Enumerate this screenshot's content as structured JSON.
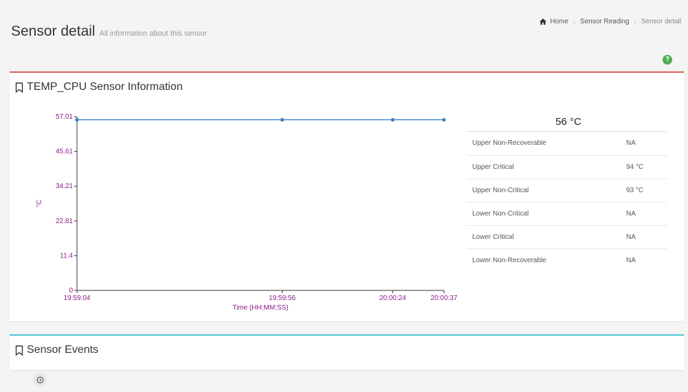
{
  "header": {
    "title": "Sensor detail",
    "subtitle": "All information about this sensor"
  },
  "breadcrumb": {
    "home": "Home",
    "sensor_reading": "Sensor Reading",
    "current": "Sensor detail"
  },
  "help": {
    "label": "?"
  },
  "sensor_box": {
    "title": "TEMP_CPU Sensor Information",
    "current_reading": "56 °C",
    "thresholds": [
      {
        "label": "Upper Non-Recoverable",
        "value": "NA"
      },
      {
        "label": "Upper Critical",
        "value": "94 °C"
      },
      {
        "label": "Upper Non-Critical",
        "value": "93 °C"
      },
      {
        "label": "Lower Non-Critical",
        "value": "NA"
      },
      {
        "label": "Lower Critical",
        "value": "NA"
      },
      {
        "label": "Lower Non-Recoverable",
        "value": "NA"
      }
    ]
  },
  "events_box": {
    "title": "Sensor Events"
  },
  "colors": {
    "accent_info": "#e06055",
    "accent_events": "#4cc7d6",
    "chart_line": "#3a7fc1",
    "axis_text": "#8b1a8b"
  },
  "chart_data": {
    "type": "line",
    "x": [
      "19:59:04",
      "19:59:56",
      "20:00:24",
      "20:00:37"
    ],
    "x_seconds": [
      0,
      52,
      80,
      93
    ],
    "series": [
      {
        "values": [
          56,
          56,
          56,
          56
        ]
      }
    ],
    "yticks": [
      "0",
      "11.4",
      "22.81",
      "34.21",
      "45.61",
      "57.01"
    ],
    "ylim": [
      0,
      57.01
    ],
    "xlabel": "Time (HH:MM:SS)",
    "ylabel": "°C",
    "grid": false
  }
}
